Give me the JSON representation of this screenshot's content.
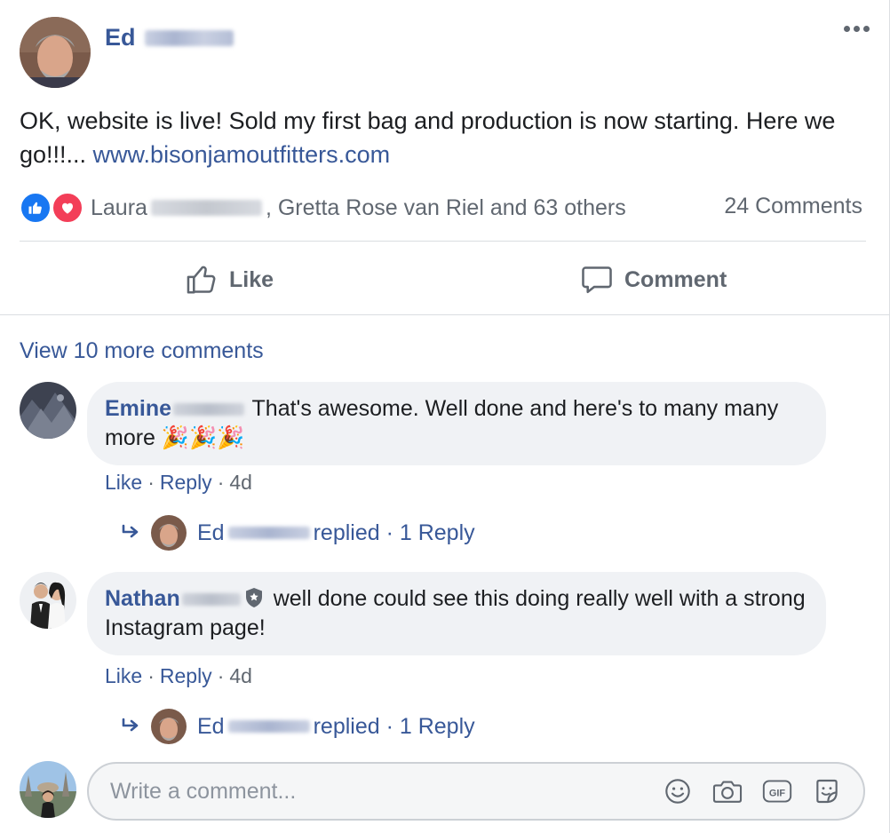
{
  "post": {
    "author_first": "Ed",
    "body_text": "OK, website is live! Sold my first bag and production is now starting. Here we go!!!... ",
    "link_text": "www.bisonjamoutfitters.com",
    "reactors_first": "Laura",
    "reactors_rest": ", Gretta Rose van Riel and 63 others",
    "comments_count": "24 Comments"
  },
  "actions": {
    "like_label": "Like",
    "comment_label": "Comment"
  },
  "comments": {
    "view_more": "View 10 more comments",
    "items": [
      {
        "name": "Emine",
        "text": "That's awesome. Well done and here's to many many more",
        "emoji": "🎉🎉🎉",
        "like": "Like",
        "reply": "Reply",
        "time": "4d",
        "reply_author": "Ed",
        "reply_text": "replied · 1 Reply"
      },
      {
        "name": "Nathan",
        "text": "well done could see this doing really well with a strong Instagram page!",
        "like": "Like",
        "reply": "Reply",
        "time": "4d",
        "reply_author": "Ed",
        "reply_text": "replied · 1 Reply"
      }
    ]
  },
  "composer": {
    "placeholder": "Write a comment..."
  },
  "icons": {
    "more": "more-options-icon",
    "like_reaction": "thumbs-up-reaction-icon",
    "love_reaction": "heart-reaction-icon",
    "like_action": "thumbs-up-icon",
    "comment_action": "speech-bubble-icon",
    "reply_arrow": "reply-arrow-icon",
    "admin_badge": "shield-star-icon",
    "emoji": "smiley-icon",
    "camera": "camera-icon",
    "gif": "gif-icon",
    "sticker": "sticker-icon"
  },
  "colors": {
    "link_blue": "#385898",
    "secondary_text": "#606770",
    "like_blue": "#1877f2",
    "love_red": "#f33e58",
    "bubble_gray": "#f0f2f5"
  }
}
